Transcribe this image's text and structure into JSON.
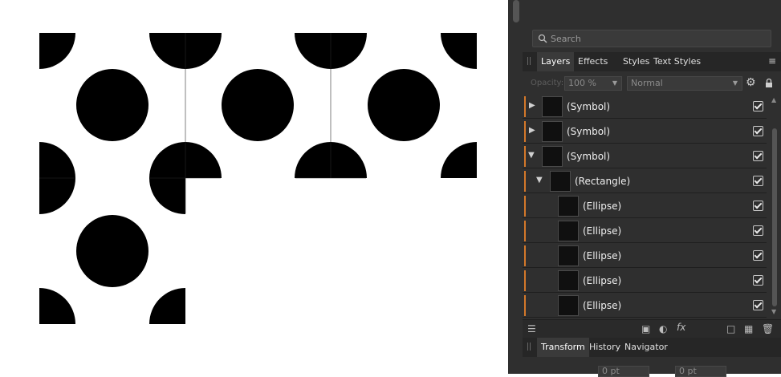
{
  "search": {
    "placeholder": "Search"
  },
  "tabs_top": [
    {
      "label": "Layers",
      "active": true
    },
    {
      "label": "Effects",
      "active": false
    },
    {
      "label": "Styles",
      "active": false
    },
    {
      "label": "Text Styles",
      "active": false
    }
  ],
  "layer_controls": {
    "opacity_label": "Opacity:",
    "opacity_value": "100 %",
    "blend_mode": "Normal"
  },
  "layers": [
    {
      "name": "(Symbol)",
      "expander": "collapsed",
      "depth": 0,
      "visible": true
    },
    {
      "name": "(Symbol)",
      "expander": "collapsed",
      "depth": 0,
      "visible": true
    },
    {
      "name": "(Symbol)",
      "expander": "expanded",
      "depth": 0,
      "visible": true
    },
    {
      "name": "(Rectangle)",
      "expander": "expanded",
      "depth": 1,
      "visible": true
    },
    {
      "name": "(Ellipse)",
      "expander": "none",
      "depth": 2,
      "visible": true
    },
    {
      "name": "(Ellipse)",
      "expander": "none",
      "depth": 2,
      "visible": true
    },
    {
      "name": "(Ellipse)",
      "expander": "none",
      "depth": 2,
      "visible": true
    },
    {
      "name": "(Ellipse)",
      "expander": "none",
      "depth": 2,
      "visible": true
    },
    {
      "name": "(Ellipse)",
      "expander": "none",
      "depth": 2,
      "visible": true
    }
  ],
  "bottom_icons": {
    "fx": "fx",
    "names": [
      "layers-stack-icon",
      "mask-icon",
      "adjustment-icon",
      "fx-icon",
      "new-layer-icon",
      "pixel-layer-icon",
      "trash-icon"
    ]
  },
  "tabs_bottom": [
    {
      "label": "Transform",
      "active": true
    },
    {
      "label": "History",
      "active": false
    },
    {
      "label": "Navigator",
      "active": false
    }
  ],
  "transform": {
    "x_value": "0 pt",
    "w_value": "0 pt"
  },
  "colors": {
    "panel_bg": "#2f2f2f",
    "accent": "#d4782a",
    "canvas_bg": "#ffffff",
    "shape_fill": "#000000"
  }
}
